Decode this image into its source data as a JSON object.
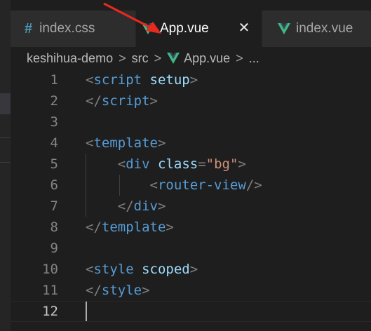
{
  "tabs": [
    {
      "label": "index.css",
      "icon": "hash-icon",
      "active": false
    },
    {
      "label": "App.vue",
      "icon": "vue-icon",
      "active": true
    },
    {
      "label": "index.vue",
      "icon": "vue-icon",
      "active": false
    }
  ],
  "tab_icons": {
    "css_hash": "#",
    "close": "✕"
  },
  "breadcrumb": {
    "items": [
      "keshihua-demo",
      "src",
      "App.vue",
      "..."
    ],
    "separator": ">"
  },
  "editor": {
    "line_numbers": [
      "1",
      "2",
      "3",
      "4",
      "5",
      "6",
      "7",
      "8",
      "9",
      "10",
      "11",
      "12"
    ],
    "active_line": "12"
  },
  "colors": {
    "vue_green": "#41b883",
    "vue_dark": "#34495e",
    "tag": "#569cd6",
    "attr": "#9cdcfe",
    "string": "#ce9178",
    "punct": "#808080",
    "arrow": "#e8291e"
  }
}
